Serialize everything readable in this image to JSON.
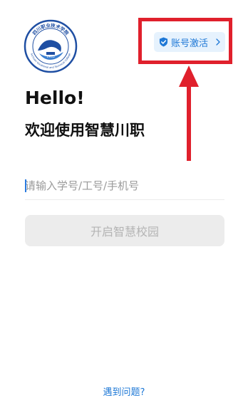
{
  "school": {
    "logo_text_cn": "四川职业技术学院",
    "logo_text_en": "Sichuan Vocational and Technical College",
    "logo_year": "1935"
  },
  "header": {
    "activate_label": "账号激活"
  },
  "greeting": {
    "hello": "Hello!",
    "welcome": "欢迎使用智慧川职"
  },
  "login": {
    "id_placeholder": "请输入学号/工号/手机号",
    "id_value": "",
    "submit_label": "开启智慧校园"
  },
  "footer": {
    "help_label": "遇到问题?"
  },
  "colors": {
    "accent": "#1e78d6",
    "annotation": "#e0202c",
    "button_disabled": "#ececec"
  },
  "icons": [
    "school-logo-icon",
    "shield-check-icon",
    "chevron-right-icon",
    "annotation-arrow-icon"
  ]
}
